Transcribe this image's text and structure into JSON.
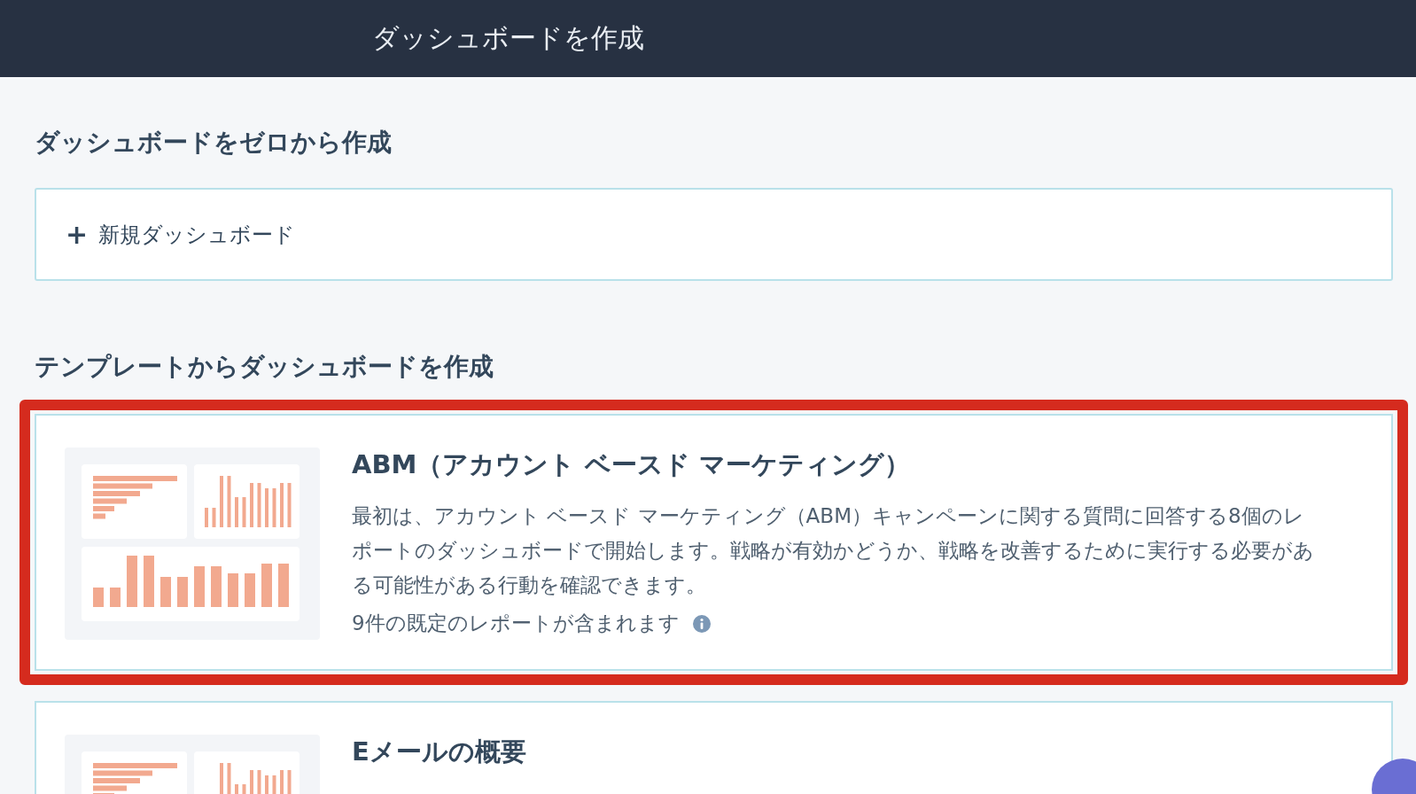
{
  "header": {
    "title": "ダッシュボードを作成"
  },
  "scratch": {
    "heading": "ダッシュボードをゼロから作成",
    "new_button": {
      "icon": "+",
      "label": "新規ダッシュボード"
    }
  },
  "templates": {
    "heading": "テンプレートからダッシュボードを作成",
    "items": [
      {
        "title": "ABM（アカウント ベースド マーケティング）",
        "description": "最初は、アカウント ベースド マーケティング（ABM）キャンペーンに関する質問に回答する8個のレポートのダッシュボードで開始します。戦略が有効かどうか、戦略を改善するために実行する必要がある可能性がある行動を確認できます。",
        "reports": "9件の既定のレポートが含まれます",
        "highlighted": true
      },
      {
        "title": "Eメールの概要",
        "highlighted": false
      }
    ]
  }
}
